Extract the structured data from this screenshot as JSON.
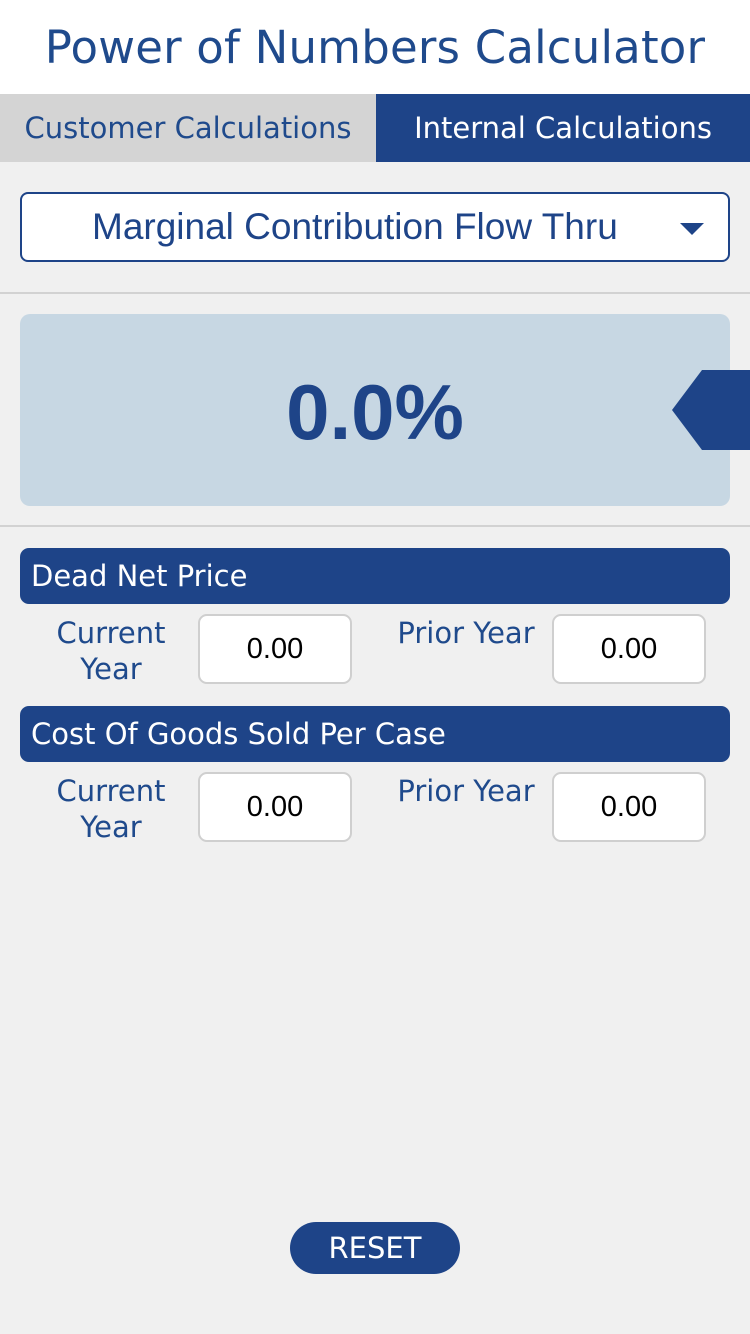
{
  "app": {
    "title": "Power of Numbers Calculator"
  },
  "tabs": [
    {
      "label": "Customer Calculations",
      "active": false
    },
    {
      "label": "Internal Calculations",
      "active": true
    }
  ],
  "calculation_select": {
    "selected": "Marginal Contribution Flow Thru"
  },
  "result": {
    "value": "0.0%"
  },
  "sections": [
    {
      "title": "Dead Net Price",
      "current_label": "Current Year",
      "current_value": "0.00",
      "prior_label": "Prior Year",
      "prior_value": "0.00"
    },
    {
      "title": "Cost Of Goods Sold Per Case",
      "current_label": "Current Year",
      "current_value": "0.00",
      "prior_label": "Prior Year",
      "prior_value": "0.00"
    }
  ],
  "actions": {
    "reset_label": "RESET"
  },
  "colors": {
    "primary": "#1e4488",
    "result_bg": "#c7d7e3",
    "page_bg": "#f0f0f0",
    "inactive_tab": "#d4d4d4"
  }
}
